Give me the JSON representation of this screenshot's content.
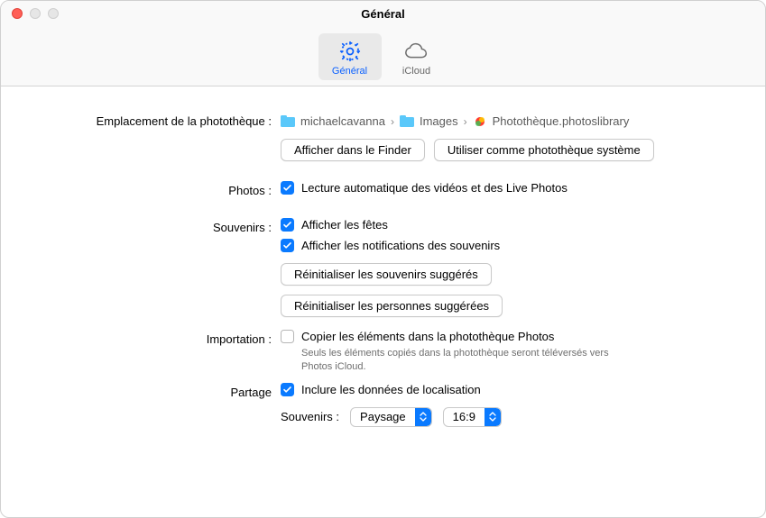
{
  "window": {
    "title": "Général"
  },
  "toolbar": {
    "general": "Général",
    "icloud": "iCloud"
  },
  "loc": {
    "label": "Emplacement de la photothèque :",
    "bc1": "michaelcavanna",
    "bc2": "Images",
    "bc3": "Photothèque.photoslibrary",
    "btn_finder": "Afficher dans le Finder",
    "btn_system": "Utiliser comme photothèque système"
  },
  "photos": {
    "label": "Photos :",
    "autoplay": "Lecture automatique des vidéos et des Live Photos"
  },
  "memories": {
    "label": "Souvenirs :",
    "show_holidays": "Afficher les fêtes",
    "show_notifications": "Afficher les notifications des souvenirs",
    "btn_reset_memories": "Réinitialiser les souvenirs suggérés",
    "btn_reset_people": "Réinitialiser les personnes suggérées"
  },
  "import": {
    "label": "Importation :",
    "copy_items": "Copier les éléments dans la photothèque Photos",
    "note": "Seuls les éléments copiés dans la photothèque seront téléversés vers Photos iCloud."
  },
  "sharing": {
    "label": "Partage",
    "include_location": "Inclure les données de localisation",
    "sub_label": "Souvenirs :",
    "orientation": "Paysage",
    "ratio": "16:9"
  }
}
